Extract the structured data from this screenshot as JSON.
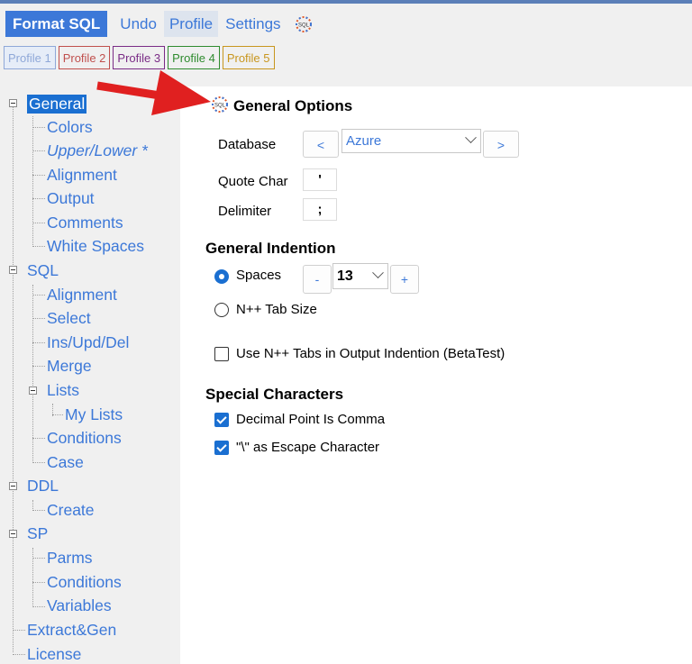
{
  "toolbar": {
    "format_sql": "Format SQL",
    "undo": "Undo",
    "profile": "Profile",
    "settings": "Settings",
    "settings_icon": "sql-settings-icon"
  },
  "profiles": [
    {
      "label": "Profile 1",
      "color": "#8fa8d8"
    },
    {
      "label": "Profile 2",
      "color": "#c0504d"
    },
    {
      "label": "Profile 3",
      "color": "#7a2c86"
    },
    {
      "label": "Profile 4",
      "color": "#2e8b2e"
    },
    {
      "label": "Profile 5",
      "color": "#c8961e"
    }
  ],
  "tree": {
    "general": "General",
    "colors": "Colors",
    "upper_lower": "Upper/Lower *",
    "alignment": "Alignment",
    "output": "Output",
    "comments": "Comments",
    "white_spaces": "White Spaces",
    "sql": "SQL",
    "sql_alignment": "Alignment",
    "select": "Select",
    "ins_upd_del": "Ins/Upd/Del",
    "merge": "Merge",
    "lists": "Lists",
    "my_lists": "My Lists",
    "conditions": "Conditions",
    "case": "Case",
    "ddl": "DDL",
    "create": "Create",
    "sp": "SP",
    "parms": "Parms",
    "sp_conditions": "Conditions",
    "variables": "Variables",
    "extract_gen": "Extract&Gen",
    "license": "License"
  },
  "general_options": {
    "title": "General Options",
    "database_label": "Database",
    "prev": "<",
    "database_value": "Azure",
    "next": ">",
    "quote_char_label": "Quote Char",
    "quote_char_value": "'",
    "delimiter_label": "Delimiter",
    "delimiter_value": ";"
  },
  "general_indention": {
    "title": "General Indention",
    "spaces_label": "Spaces",
    "spaces_selected": true,
    "minus": "-",
    "spaces_value": "13",
    "plus": "+",
    "tab_size_label": "N++ Tab Size",
    "use_tabs_label": "Use N++ Tabs in Output Indention (BetaTest)",
    "use_tabs_checked": false
  },
  "special_characters": {
    "title": "Special Characters",
    "decimal_point_label": "Decimal Point Is Comma",
    "decimal_point_checked": true,
    "escape_label": "\"\\\" as Escape Character",
    "escape_checked": true
  },
  "colors": {
    "accent": "#3c78d8",
    "selected": "#1a6fd1",
    "arrow": "#e02020"
  }
}
